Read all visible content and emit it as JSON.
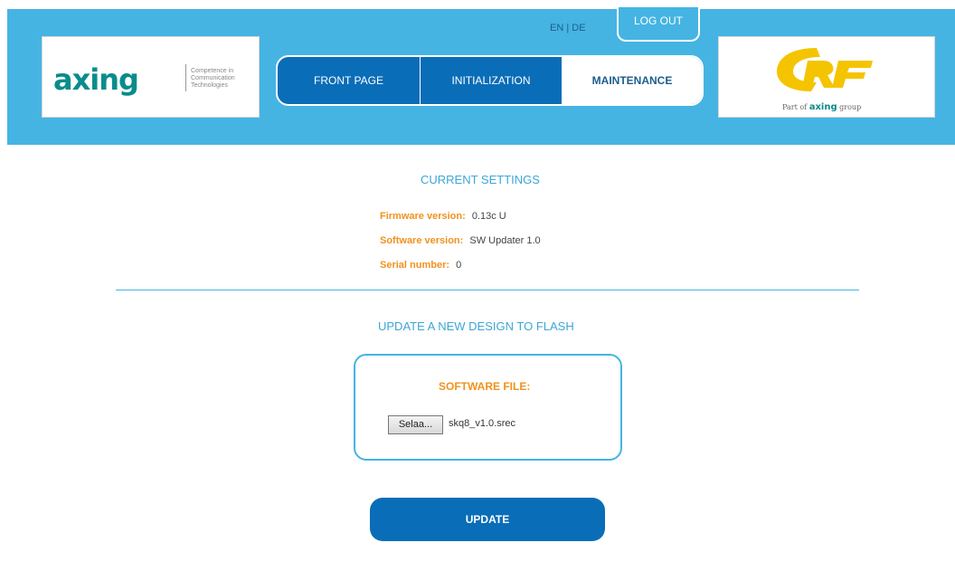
{
  "header": {
    "lang_toggle": "EN | DE",
    "logout_label": "LOG OUT",
    "left_logo": {
      "wordmark": "axing",
      "tagline": "Competence in Communication Technologies"
    },
    "right_logo": {
      "wordmark": "RF",
      "subline_prefix": "Part of",
      "subline_brand": "axing",
      "subline_suffix": "group"
    },
    "tabs": [
      {
        "label": "FRONT PAGE",
        "active": false
      },
      {
        "label": "INITIALIZATION",
        "active": false
      },
      {
        "label": "MAINTENANCE",
        "active": true
      }
    ]
  },
  "current_settings": {
    "title": "CURRENT SETTINGS",
    "firmware_label": "Firmware version:",
    "firmware_value": "0.13c U",
    "software_label": "Software version:",
    "software_value": "SW Updater 1.0",
    "serial_label": "Serial number:",
    "serial_value": "0"
  },
  "update_section": {
    "title": "UPDATE A NEW DESIGN TO FLASH",
    "file_label": "SOFTWARE FILE:",
    "browse_label": "Selaa...",
    "file_name": "skq8_v1.0.srec",
    "update_label": "UPDATE"
  },
  "colors": {
    "header_bg": "#45b4e3",
    "nav_blue": "#0a6db8",
    "accent_orange": "#f0921e",
    "section_title": "#3da6d6",
    "axing_teal": "#0a8c8c",
    "rf_yellow": "#f5c400"
  }
}
